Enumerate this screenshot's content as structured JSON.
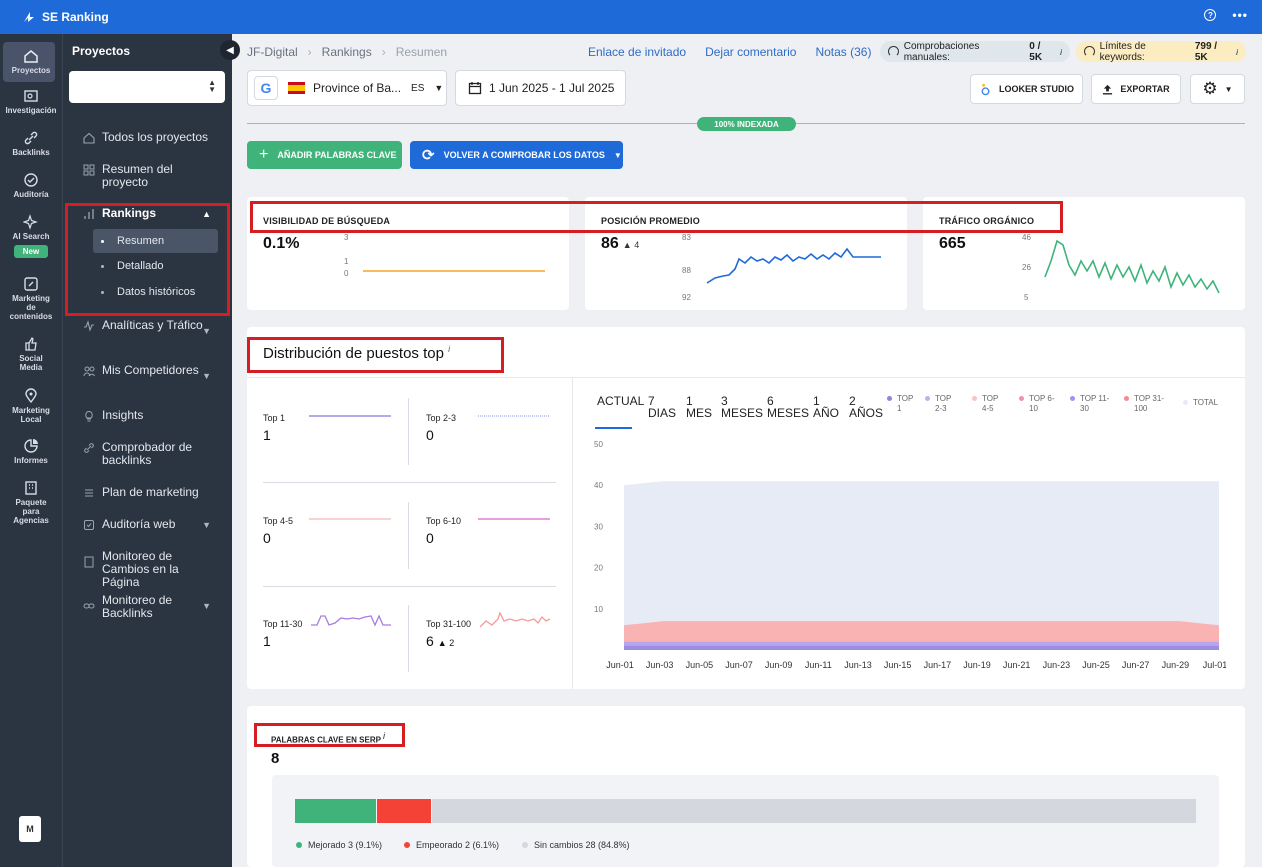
{
  "app": {
    "name": "SE Ranking",
    "help_icon": "help-circle-icon",
    "more_icon": "more-dots-icon"
  },
  "rail": [
    {
      "label": "Proyectos",
      "icon": "home-icon",
      "active": true
    },
    {
      "label": "Investigación",
      "icon": "research-icon"
    },
    {
      "label": "Backlinks",
      "icon": "link-icon"
    },
    {
      "label": "Auditoría",
      "icon": "check-circle-icon"
    },
    {
      "label": "AI Search",
      "icon": "sparkle-icon",
      "badge": "New"
    },
    {
      "label": "Marketing de contenidos",
      "icon": "edit-icon"
    },
    {
      "label": "Social Media",
      "icon": "thumbs-up-icon"
    },
    {
      "label": "Marketing Local",
      "icon": "map-pin-icon"
    },
    {
      "label": "Informes",
      "icon": "pie-chart-icon"
    },
    {
      "label": "Paquete para Agencias",
      "icon": "building-icon"
    }
  ],
  "avatar": "M",
  "sidebar": {
    "title": "Proyectos",
    "items": [
      {
        "label": "Todos los proyectos",
        "icon": "home-outline-icon"
      },
      {
        "label": "Resumen del proyecto",
        "icon": "grid-icon"
      },
      {
        "label": "Rankings",
        "icon": "bar-chart-icon",
        "expanded": true
      },
      {
        "label": "Analíticas y Tráfico",
        "icon": "activity-icon"
      },
      {
        "label": "Mis Competidores",
        "icon": "users-icon"
      },
      {
        "label": "Insights",
        "icon": "lightbulb-icon"
      },
      {
        "label": "Comprobador de backlinks",
        "icon": "link-icon"
      },
      {
        "label": "Plan de marketing",
        "icon": "list-icon"
      },
      {
        "label": "Auditoría web",
        "icon": "audit-icon"
      },
      {
        "label": "Monitoreo de Cambios en la Página",
        "icon": "page-icon"
      },
      {
        "label": "Monitoreo de Backlinks",
        "icon": "chain-icon"
      }
    ],
    "rankings_sub": [
      "Resumen",
      "Detallado",
      "Datos históricos"
    ]
  },
  "breadcrumb": [
    "JF-Digital",
    "Rankings",
    "Resumen"
  ],
  "header_links": [
    "Enlace de invitado",
    "Dejar comentario",
    "Notas (36)"
  ],
  "pills": {
    "manual_label": "Comprobaciones manuales:",
    "manual_value": "0 / 5K",
    "keywords_label": "Límites de keywords:",
    "keywords_value": "799 / 5K",
    "info": "i"
  },
  "controls": {
    "engine": "G",
    "location": "Province of Ba...",
    "lang": "ES",
    "date_range": "1 Jun 2025 - 1 Jul 2025",
    "looker": "LOOKER STUDIO",
    "export": "EXPORTAR"
  },
  "index_badge": "100% INDEXADA",
  "actions": {
    "add": "AÑADIR PALABRAS CLAVE",
    "recheck": "VOLVER A COMPROBAR LOS DATOS"
  },
  "metrics": {
    "visibility": {
      "title": "VISIBILIDAD DE BÚSQUEDA",
      "value": "0.1%",
      "axis": [
        "3",
        "1",
        "0"
      ]
    },
    "position": {
      "title": "POSICIÓN PROMEDIO",
      "value": "86",
      "delta": "▲ 4",
      "axis": [
        "83",
        "88",
        "92"
      ]
    },
    "traffic": {
      "title": "TRÁFICO ORGÁNICO",
      "value": "665",
      "axis": [
        "46",
        "26",
        "5"
      ]
    }
  },
  "distribution": {
    "title": "Distribución de puestos top",
    "cells": [
      {
        "label": "Top 1",
        "value": "1",
        "color": "#9b8de0"
      },
      {
        "label": "Top 2-3",
        "value": "0",
        "color": "#b0b4ee"
      },
      {
        "label": "Top 4-5",
        "value": "0",
        "color": "#f5c2c2"
      },
      {
        "label": "Top 6-10",
        "value": "0",
        "color": "#e47fd0"
      },
      {
        "label": "Top 11-30",
        "value": "1",
        "color": "#a77be0"
      },
      {
        "label": "Top 31-100",
        "value": "6",
        "delta": "▲ 2",
        "color": "#f59a9a"
      }
    ],
    "tabs": [
      "ACTUAL",
      "7 DIAS",
      "1 MES",
      "3 MESES",
      "6 MESES",
      "1 AÑO",
      "2 AÑOS"
    ],
    "legend": [
      {
        "label": "TOP 1",
        "color": "#8f84e0"
      },
      {
        "label": "TOP 2-3",
        "color": "#b7b5ef"
      },
      {
        "label": "TOP 4-5",
        "color": "#f6c6c6"
      },
      {
        "label": "TOP 6-10",
        "color": "#ef8fb6"
      },
      {
        "label": "TOP 11-30",
        "color": "#a98df0"
      },
      {
        "label": "TOP 31-100",
        "color": "#f58b8b"
      },
      {
        "label": "TOTAL",
        "color": "#e7ebf6"
      }
    ]
  },
  "chart_data": {
    "type": "area",
    "x": [
      "Jun-01",
      "Jun-03",
      "Jun-05",
      "Jun-07",
      "Jun-09",
      "Jun-11",
      "Jun-13",
      "Jun-15",
      "Jun-17",
      "Jun-19",
      "Jun-21",
      "Jun-23",
      "Jun-25",
      "Jun-27",
      "Jun-29",
      "Jul-01"
    ],
    "ylim": [
      0,
      50
    ],
    "yticks": [
      10,
      20,
      30,
      40,
      50
    ],
    "series": [
      {
        "name": "TOTAL",
        "values": [
          40,
          41,
          41,
          41,
          41,
          41,
          41,
          41,
          41,
          41,
          41,
          41,
          41,
          41,
          41,
          41
        ]
      },
      {
        "name": "TOP 31-100",
        "values": [
          6,
          7,
          7,
          7,
          7,
          7,
          7,
          7,
          7,
          7,
          7,
          7,
          7,
          7,
          7,
          6
        ]
      },
      {
        "name": "TOP 11-30",
        "values": [
          2,
          2,
          2,
          2,
          2,
          2,
          2,
          2,
          2,
          2,
          2,
          2,
          2,
          2,
          2,
          2
        ]
      },
      {
        "name": "TOP 1",
        "values": [
          1,
          1,
          1,
          1,
          1,
          1,
          1,
          1,
          1,
          1,
          1,
          1,
          1,
          1,
          1,
          1
        ]
      }
    ]
  },
  "serp": {
    "title": "PALABRAS CLAVE EN SERP",
    "value": "8",
    "info": "i",
    "bar": {
      "improved": 3,
      "declined": 2,
      "unchanged": 28
    },
    "legend": {
      "improved": "Mejorado 3 (9.1%)",
      "declined": "Empeorado 2 (6.1%)",
      "unchanged": "Sin cambios 28 (84.8%)"
    },
    "colors": {
      "improved": "#3fb37a",
      "declined": "#f44336",
      "unchanged": "#d5d7de"
    }
  }
}
